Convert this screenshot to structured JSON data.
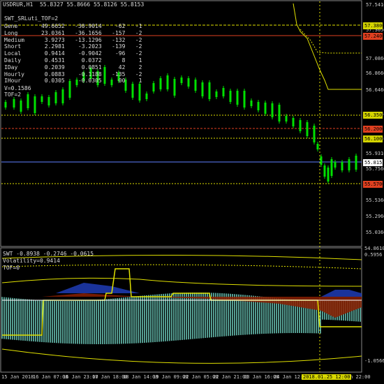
{
  "header": {
    "symbol_line": "USDRUR,H1  55.8327 55.8666 55.8126 55.8153"
  },
  "indicator_name": "SWT_SRLuti_TOF=2",
  "stats_rows": [
    "Gene       49.6652   -30.9014    -62   -1",
    "Long       23.0361   -36.1656   -157   -2",
    "Medium      3.9273   -13.1296   -132   -2",
    "Short       2.2981    -3.2023   -139   -2",
    "Local       0.9414    -0.9042    -96   -2",
    "Daily       0.4531     0.0372      8    1",
    "IDay        0.2039     0.0851     42    2",
    "Hourly      0.0883    -0.1188   -135   -2",
    "IHour       0.0305    -0.0305     00    1"
  ],
  "v_line": "V=0.1586",
  "tof_line": "TOF=2",
  "price_axis": [
    "57.5410",
    "57.3050",
    "57.0860",
    "56.8660",
    "56.6460",
    "56.4260",
    "56.2050",
    "55.9310",
    "55.7560",
    "55.5360",
    "55.2960",
    "55.0360"
  ],
  "price_tags": [
    {
      "text": "57.3800",
      "bg": "#d4d400"
    },
    {
      "text": "57.2400",
      "bg": "#e04020"
    },
    {
      "text": "56.3500",
      "bg": "#d4d400"
    },
    {
      "text": "56.2000",
      "bg": "#e04020"
    },
    {
      "text": "56.1000",
      "bg": "#d4d400"
    },
    {
      "text": "55.8153",
      "bg": "#ffffff"
    },
    {
      "text": "55.5700",
      "bg": "#e04020"
    }
  ],
  "sub_header": "SWT -0.8938 -0.2746 -0.0615",
  "volatility_line": "Volatility=0.9414",
  "sub_tof": "TOF=0",
  "sub_axis_top": "0.5956",
  "sub_axis_bottom": "-1.0566",
  "sub_axis_mid": "54.8610",
  "time_labels": [
    "15 Jan 2018",
    "16 Jan 07:00",
    "16 Jan 23:00",
    "17 Jan 18:00",
    "18 Jan 14:00",
    "19 Jan 09:00",
    "22 Jan 05:00",
    "22 Jan 21:00",
    "23 Jan 16:00",
    "24 Jan 12:00",
    "25 Jan 22:00"
  ],
  "time_highlight": "2018.01.25 12:00",
  "colors": {
    "bull": "#00e000",
    "bear": "#00e000",
    "yellow": "#e0e000",
    "red": "#e04020",
    "blue": "#6080ff",
    "teal": "#70d0c0",
    "darkred": "#8a2000"
  }
}
